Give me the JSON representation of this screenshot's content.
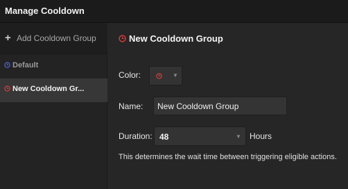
{
  "window": {
    "title": "Manage Cooldown"
  },
  "sidebar": {
    "add_label": "Add Cooldown Group",
    "items": [
      {
        "label": "Default",
        "icon": "clock-icon",
        "icon_color": "#4a63d8"
      },
      {
        "label": "New Cooldown Gr...",
        "icon": "clock-icon",
        "icon_color": "#d63a3a"
      }
    ]
  },
  "editor": {
    "title": "New Cooldown Group",
    "title_icon_color": "#d63a3a",
    "color": {
      "label": "Color:",
      "value_icon": "clock-icon",
      "value_color": "#d63a3a"
    },
    "name": {
      "label": "Name:",
      "value": "New Cooldown Group"
    },
    "duration": {
      "label": "Duration:",
      "value": "48",
      "unit": "Hours"
    },
    "help_text": "This determines the wait time between triggering eligible actions."
  }
}
